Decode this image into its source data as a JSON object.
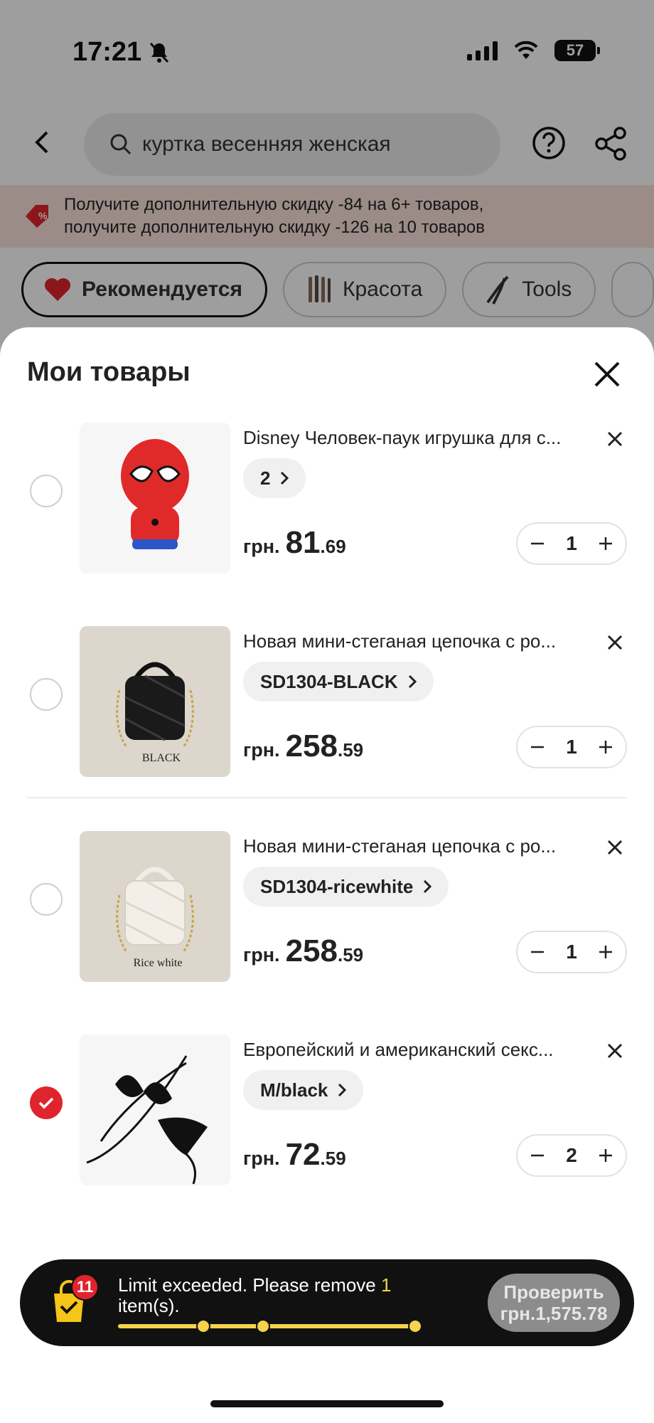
{
  "status_bar": {
    "time": "17:21",
    "battery": "57"
  },
  "search": {
    "query": "куртка весенняя женская"
  },
  "promo": {
    "line1": "Получите дополнительную скидку -84 на 6+ товаров,",
    "line2": "получите дополнительную скидку -126 на 10 товаров"
  },
  "chips": [
    {
      "label": "Рекомендуется",
      "icon": "heart-icon"
    },
    {
      "label": "Красота",
      "icon": "brushes-icon"
    },
    {
      "label": "Tools",
      "icon": "pliers-icon"
    }
  ],
  "sheet": {
    "title": "Мои товары"
  },
  "items": [
    {
      "title": "Disney Человек-паук игрушка для с...",
      "variant": "2",
      "currency": "грн.",
      "price_int": "81",
      "price_frac": ".69",
      "qty": "1",
      "checked": false
    },
    {
      "title": "Новая мини-стеганая цепочка с ро...",
      "variant": "SD1304-BLACK",
      "currency": "грн.",
      "price_int": "258",
      "price_frac": ".59",
      "qty": "1",
      "checked": false,
      "image_caption": "BLACK"
    },
    {
      "title": "Новая мини-стеганая цепочка с ро...",
      "variant": "SD1304-ricewhite",
      "currency": "грн.",
      "price_int": "258",
      "price_frac": ".59",
      "qty": "1",
      "checked": false,
      "image_caption": "Rice white"
    },
    {
      "title": "Европейский и американский секс...",
      "variant": "M/black",
      "currency": "грн.",
      "price_int": "72",
      "price_frac": ".59",
      "qty": "2",
      "checked": true
    }
  ],
  "limit_bar": {
    "badge": "11",
    "text_before": "Limit exceeded. Please remove ",
    "highlight": "1",
    "text_after": " item(s).",
    "checkout_label": "Проверить",
    "checkout_total": "грн.1,575.78"
  },
  "colors": {
    "accent": "#e0242e",
    "progress": "#f5d34a",
    "promo_bg": "#fbe3dc"
  }
}
